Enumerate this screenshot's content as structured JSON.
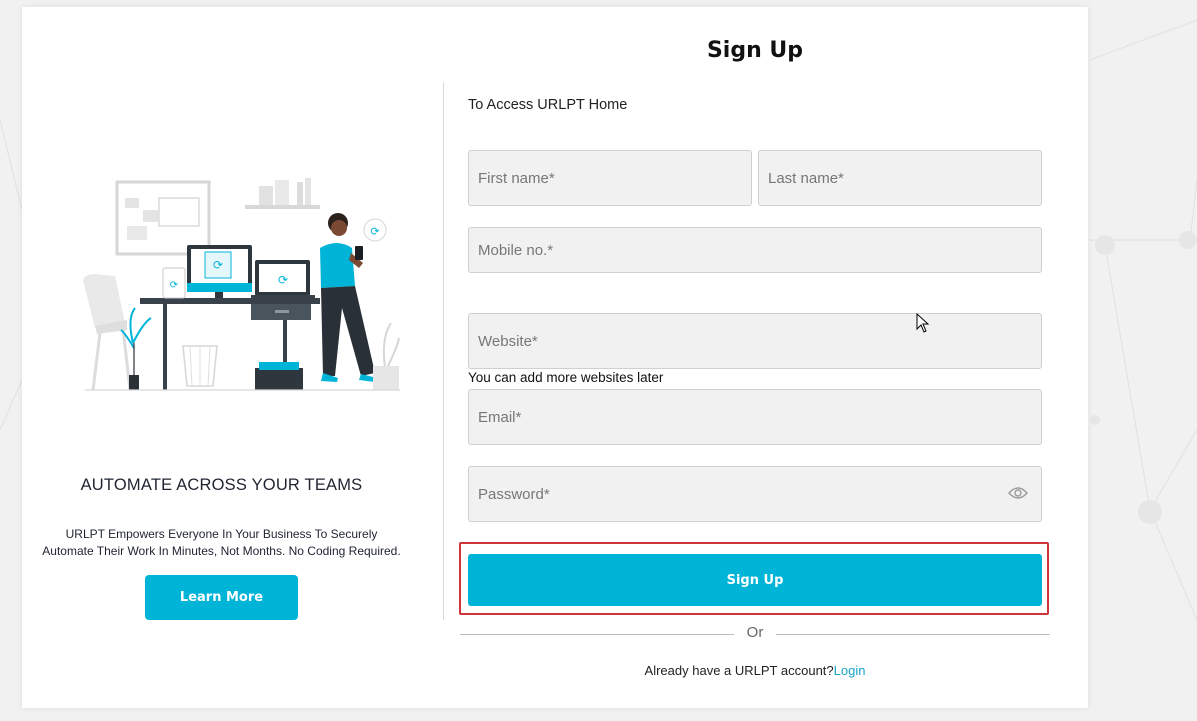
{
  "left": {
    "heading": "AUTOMATE ACROSS YOUR TEAMS",
    "description": "URLPT Empowers Everyone In Your Business To Securely Automate Their Work In Minutes, Not Months. No Coding Required.",
    "learn_more_label": "Learn More",
    "illustration_icon": "workspace-illustration"
  },
  "form": {
    "title": "Sign Up",
    "subtitle": "To Access URLPT Home",
    "first_name_placeholder": "First name*",
    "last_name_placeholder": "Last name*",
    "mobile_placeholder": "Mobile no.*",
    "website_placeholder": "Website*",
    "website_hint": "You can add more websites later",
    "email_placeholder": "Email*",
    "password_placeholder": "Password*",
    "password_toggle_icon": "eye-icon",
    "submit_label": "Sign Up",
    "or_text": "Or",
    "login_prompt": "Already have a URLPT account?",
    "login_link": "Login"
  },
  "colors": {
    "accent": "#00b4d8",
    "highlight_border": "#d0343c",
    "link": "#17a6c6"
  }
}
